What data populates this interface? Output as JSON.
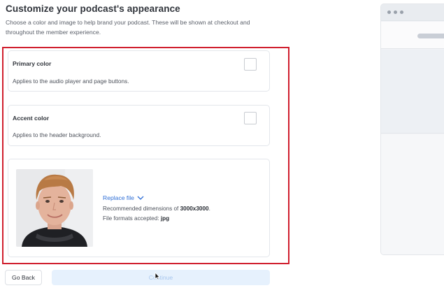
{
  "page": {
    "title": "Customize your podcast's appearance",
    "description": "Choose a color and image to help brand your podcast. These will be shown at checkout and throughout the member experience."
  },
  "primary_color": {
    "title": "Primary color",
    "description": "Applies to the audio player and page buttons."
  },
  "accent_color": {
    "title": "Accent color",
    "description": "Applies to the header background."
  },
  "image": {
    "replace_label": "Replace file",
    "dimensions_prefix": "Recommended dimensions of ",
    "dimensions_value": "3000x3000",
    "dimensions_suffix": ".",
    "formats_prefix": "File formats accepted: ",
    "formats_value": "jpg"
  },
  "buttons": {
    "back_label": "Go Back",
    "continue_label": "Continue"
  },
  "colors": {
    "highlight": "#d01f2e",
    "link": "#2f6fd6",
    "continue_bg": "#e6f1fd"
  },
  "icons": {
    "replace_dropdown": "chevron-down-icon",
    "cursor": "mouse-pointer-icon"
  }
}
